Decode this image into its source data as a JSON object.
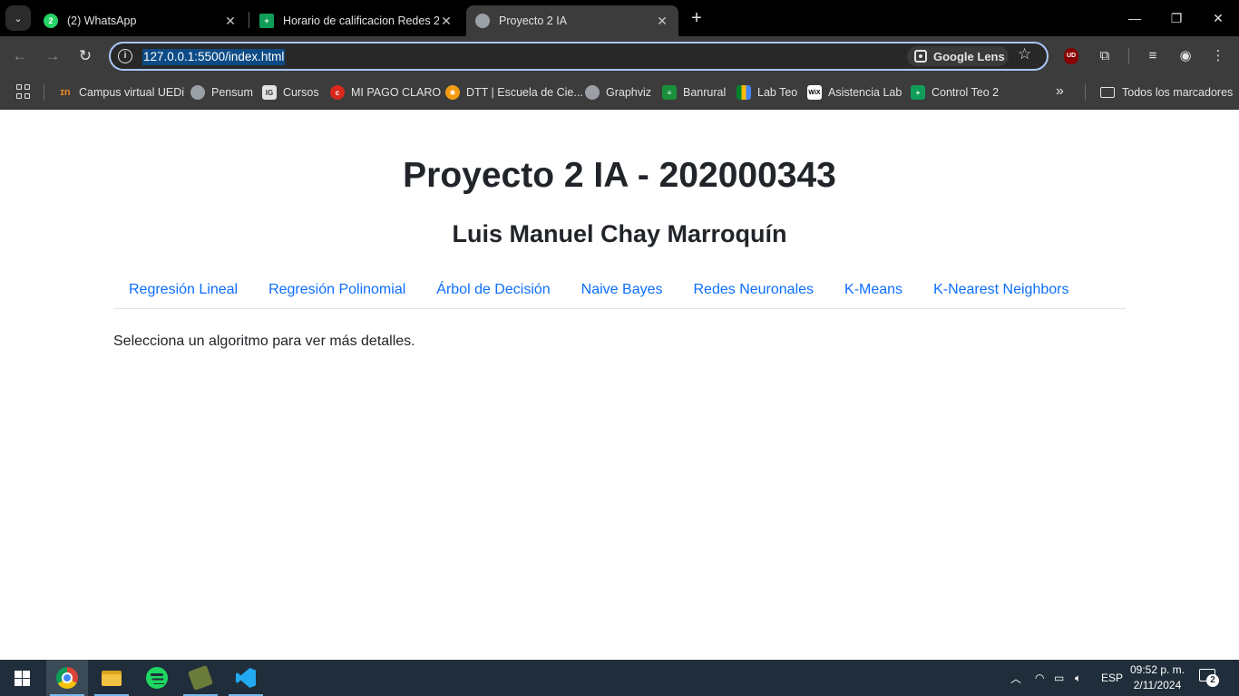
{
  "browser": {
    "tabs": [
      {
        "title": "(2) WhatsApp",
        "favicon": "whatsapp-icon",
        "badge": "2",
        "active": false
      },
      {
        "title": "Horario de calificacion Redes 2",
        "favicon": "google-sheets-icon",
        "active": false
      },
      {
        "title": "Proyecto 2 IA",
        "favicon": "globe-icon",
        "active": true
      }
    ],
    "url": "127.0.0.1:5500/index.html",
    "lens_label": "Google Lens",
    "ublock_label": "UD",
    "bookmarks": [
      {
        "label": "Campus virtual UEDi",
        "icon": "uedi-icon"
      },
      {
        "label": "Pensum",
        "icon": "globe-icon"
      },
      {
        "label": "Cursos",
        "icon": "cursos-icon"
      },
      {
        "label": "MI PAGO CLARO",
        "icon": "claro-icon"
      },
      {
        "label": "DTT | Escuela de Cie...",
        "icon": "dtt-icon"
      },
      {
        "label": "Graphviz",
        "icon": "globe-icon"
      },
      {
        "label": "Banrural",
        "icon": "banrural-icon"
      },
      {
        "label": "Lab Teo",
        "icon": "meet-icon"
      },
      {
        "label": "Asistencia Lab",
        "icon": "wix-icon"
      },
      {
        "label": "Control Teo 2",
        "icon": "google-sheets-icon"
      }
    ],
    "all_bookmarks_label": "Todos los marcadores"
  },
  "page": {
    "title": "Proyecto 2 IA - 202000343",
    "subtitle": "Luis Manuel Chay Marroquín",
    "nav": [
      "Regresión Lineal",
      "Regresión Polinomial",
      "Árbol de Decisión",
      "Naive Bayes",
      "Redes Neuronales",
      "K-Means",
      "K-Nearest Neighbors"
    ],
    "intro": "Selecciona un algoritmo para ver más detalles."
  },
  "taskbar": {
    "apps": [
      "chrome-icon",
      "file-explorer-icon",
      "spotify-icon",
      "tool-icon",
      "vscode-icon"
    ],
    "language": "ESP",
    "time": "09:52 p. m.",
    "date": "2/11/2024",
    "notification_count": "2"
  },
  "colors": {
    "link": "#0d6efd",
    "heading": "#212529",
    "browser_frame": "#3c3c3c",
    "url_selection": "#0d4b86",
    "taskbar": "#1f2e3a"
  }
}
